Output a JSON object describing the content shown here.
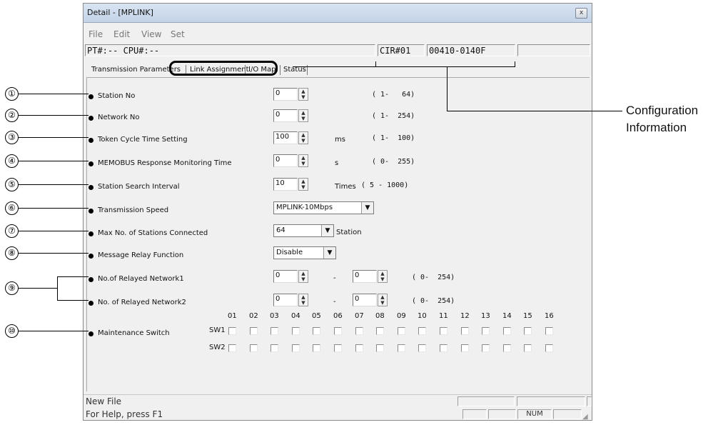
{
  "window": {
    "title": "Detail - [MPLINK]",
    "close_glyph": "x"
  },
  "menu": [
    "File",
    "Edit",
    "View",
    "Set"
  ],
  "config_bar": {
    "pt_cpu": "PT#:-- CPU#:--",
    "cir": "CIR#01",
    "code": "00410-0140F",
    "blank": ""
  },
  "tabs": [
    "Transmission Parameters",
    "Link Assignment",
    "I/O Map",
    "Status"
  ],
  "params": [
    {
      "label": "Station No",
      "value": "0",
      "unit": "",
      "range": "( 1-   64)"
    },
    {
      "label": "Network No",
      "value": "0",
      "unit": "",
      "range": "( 1-  254)"
    },
    {
      "label": "Token Cycle Time Setting",
      "value": "100",
      "unit": "ms",
      "range": "( 1-  100)"
    },
    {
      "label": "MEMOBUS Response Monitoring Time",
      "value": "0",
      "unit": "s",
      "range": "( 0-  255)"
    },
    {
      "label": "Station Search Interval",
      "value": "10",
      "unit": "Times",
      "range": "( 5 - 1000)"
    },
    {
      "label": "Transmission Speed",
      "value": "MPLINK-10Mbps"
    },
    {
      "label": "Max No. of Stations Connected",
      "value": "64",
      "unit": "Station"
    },
    {
      "label": "Message Relay Function",
      "value": "Disable"
    },
    {
      "label": "No.of Relayed Network1",
      "value": "0",
      "value2": "0",
      "dash": "-",
      "range": "( 0-  254)"
    },
    {
      "label": "No. of Relayed Network2",
      "value": "0",
      "value2": "0",
      "dash": "-",
      "range": "( 0-  254)"
    }
  ],
  "maintenance": {
    "label": "Maintenance Switch",
    "columns": [
      "01",
      "02",
      "03",
      "04",
      "05",
      "06",
      "07",
      "08",
      "09",
      "10",
      "11",
      "12",
      "13",
      "14",
      "15",
      "16"
    ],
    "rows": [
      "SW1",
      "SW2"
    ]
  },
  "statusbar": {
    "line1": "New File",
    "line2": "For Help, press F1",
    "num": "NUM"
  },
  "callouts": [
    "①",
    "②",
    "③",
    "④",
    "⑤",
    "⑥",
    "⑦",
    "⑧",
    "⑨",
    "⑩"
  ],
  "config_annotation": [
    "Configuration",
    "Information"
  ]
}
